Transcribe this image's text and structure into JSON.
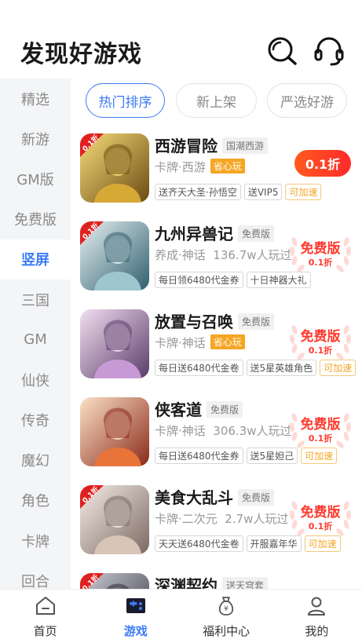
{
  "header": {
    "title": "发现好游戏",
    "search_icon": "search-icon",
    "support_icon": "headset-icon"
  },
  "sidebar": {
    "active_index": 4,
    "items": [
      "精选",
      "新游",
      "GM版",
      "免费版",
      "竖屏",
      "三国",
      "GM",
      "仙侠",
      "传奇",
      "魔幻",
      "角色",
      "卡牌",
      "回合"
    ]
  },
  "tabs": [
    {
      "label": "热门排序",
      "active": true
    },
    {
      "label": "新上架",
      "active": false
    },
    {
      "label": "严选好游",
      "active": false
    }
  ],
  "games": [
    {
      "name": "西游冒险",
      "tag": "国潮西游",
      "meta": "卡牌·西游",
      "badge": "省心玩",
      "benefits": [
        "送齐天大圣·孙悟空",
        "送VIP5"
      ],
      "speed": "可加速",
      "action": {
        "type": "discount",
        "label": "0.1折"
      },
      "thumb_badge": "0.1折"
    },
    {
      "name": "九州异兽记",
      "tag": "免费版",
      "meta": "养成·神话  136.7w人玩过",
      "badge": "",
      "benefits": [
        "每日领6480代金券",
        "十日神器大礼"
      ],
      "speed": "",
      "action": {
        "type": "free",
        "label": "免费版",
        "sub": "0.1折"
      },
      "thumb_badge": "0.1折"
    },
    {
      "name": "放置与召唤",
      "tag": "免费版",
      "meta": "卡牌·神话",
      "badge": "省心玩",
      "benefits": [
        "每日送6480代金卷",
        "送5星英雄角色"
      ],
      "speed": "可加速",
      "action": {
        "type": "free",
        "label": "免费版",
        "sub": "0.1折"
      },
      "thumb_badge": ""
    },
    {
      "name": "侠客道",
      "tag": "免费版",
      "meta": "卡牌·神话  306.3w人玩过",
      "badge": "",
      "benefits": [
        "每日送6480代金券",
        "送5星妲己"
      ],
      "speed": "可加速",
      "action": {
        "type": "free",
        "label": "免费版",
        "sub": "0.1折"
      },
      "thumb_badge": ""
    },
    {
      "name": "美食大乱斗",
      "tag": "免费版",
      "meta": "卡牌·二次元  2.7w人玩过",
      "badge": "",
      "benefits": [
        "天天送6480代金卷",
        "开服嘉年华"
      ],
      "speed": "可加速",
      "action": {
        "type": "free",
        "label": "免费版",
        "sub": "0.1折"
      },
      "thumb_badge": "0.1折"
    },
    {
      "name": "深渊契约",
      "tag": "送天穹套",
      "meta": "",
      "badge": "",
      "benefits": [],
      "speed": "",
      "action": {
        "type": "none",
        "label": ""
      },
      "thumb_badge": "0.1折"
    }
  ],
  "bottom_nav": [
    {
      "label": "首页",
      "icon": "home-icon",
      "active": false
    },
    {
      "label": "游戏",
      "icon": "gamepad-icon",
      "active": true
    },
    {
      "label": "福利中心",
      "icon": "money-bag-icon",
      "active": false
    },
    {
      "label": "我的",
      "icon": "user-icon",
      "active": false
    }
  ],
  "colors": {
    "accent": "#3d7bf6",
    "discount": "#ff3b30",
    "speed": "#f5a623"
  }
}
